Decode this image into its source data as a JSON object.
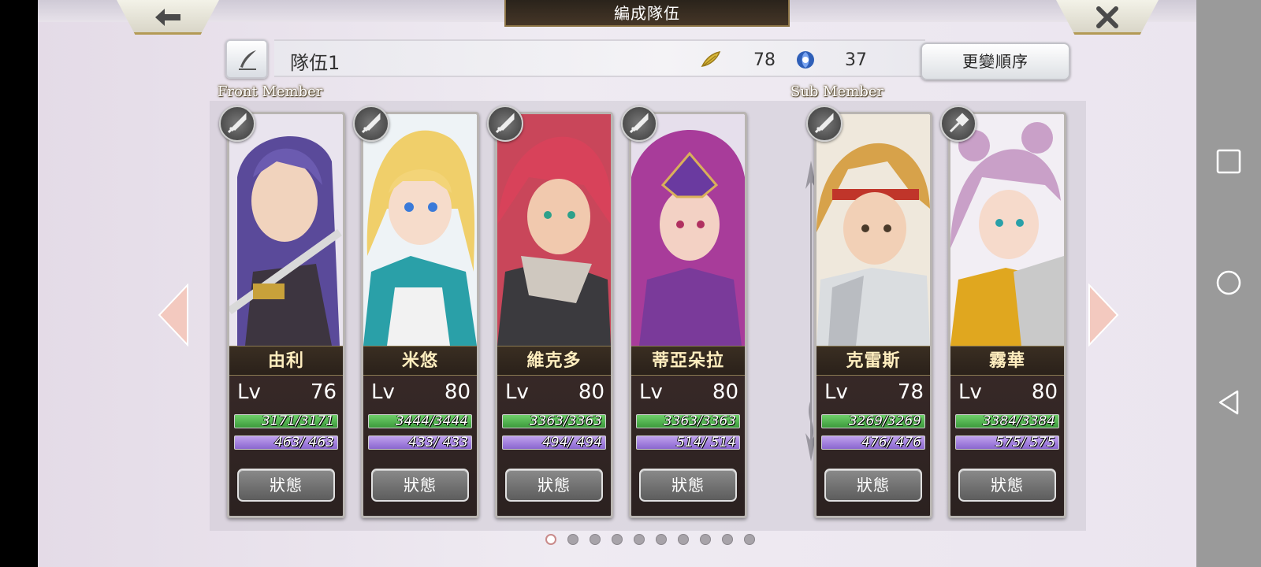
{
  "screen": {
    "title": "編成隊伍",
    "back_icon": "back-arrow-icon",
    "close_icon": "close-icon"
  },
  "party": {
    "name": "隊伍1",
    "feather_count": "78",
    "orb_count": "37",
    "reorder_label": "更變順序"
  },
  "sections": {
    "front": "Front Member",
    "sub": "Sub Member"
  },
  "members": [
    {
      "name": "由利",
      "lv_label": "Lv",
      "lv": "76",
      "hp": "3171/3171",
      "mp": "463/ 463",
      "status_label": "狀態",
      "weapon": "sword-icon"
    },
    {
      "name": "米悠",
      "lv_label": "Lv",
      "lv": "80",
      "hp": "3444/3444",
      "mp": "433/ 433",
      "status_label": "狀態",
      "weapon": "sword-icon"
    },
    {
      "name": "維克多",
      "lv_label": "Lv",
      "lv": "80",
      "hp": "3363/3363",
      "mp": "494/ 494",
      "status_label": "狀態",
      "weapon": "sword-icon"
    },
    {
      "name": "蒂亞朵拉",
      "lv_label": "Lv",
      "lv": "80",
      "hp": "3363/3363",
      "mp": "514/ 514",
      "status_label": "狀態",
      "weapon": "sword-icon"
    },
    {
      "name": "克雷斯",
      "lv_label": "Lv",
      "lv": "78",
      "hp": "3269/3269",
      "mp": "476/ 476",
      "status_label": "狀態",
      "weapon": "sword-icon"
    },
    {
      "name": "霧華",
      "lv_label": "Lv",
      "lv": "80",
      "hp": "3384/3384",
      "mp": "575/ 575",
      "status_label": "狀態",
      "weapon": "hammer-icon"
    }
  ],
  "pagination": {
    "total": 10,
    "current": 1
  },
  "colors": {
    "hp": "#4fb84a",
    "mp": "#a484e0",
    "name_text": "#ffeebf",
    "card_bg": "#33272a"
  }
}
